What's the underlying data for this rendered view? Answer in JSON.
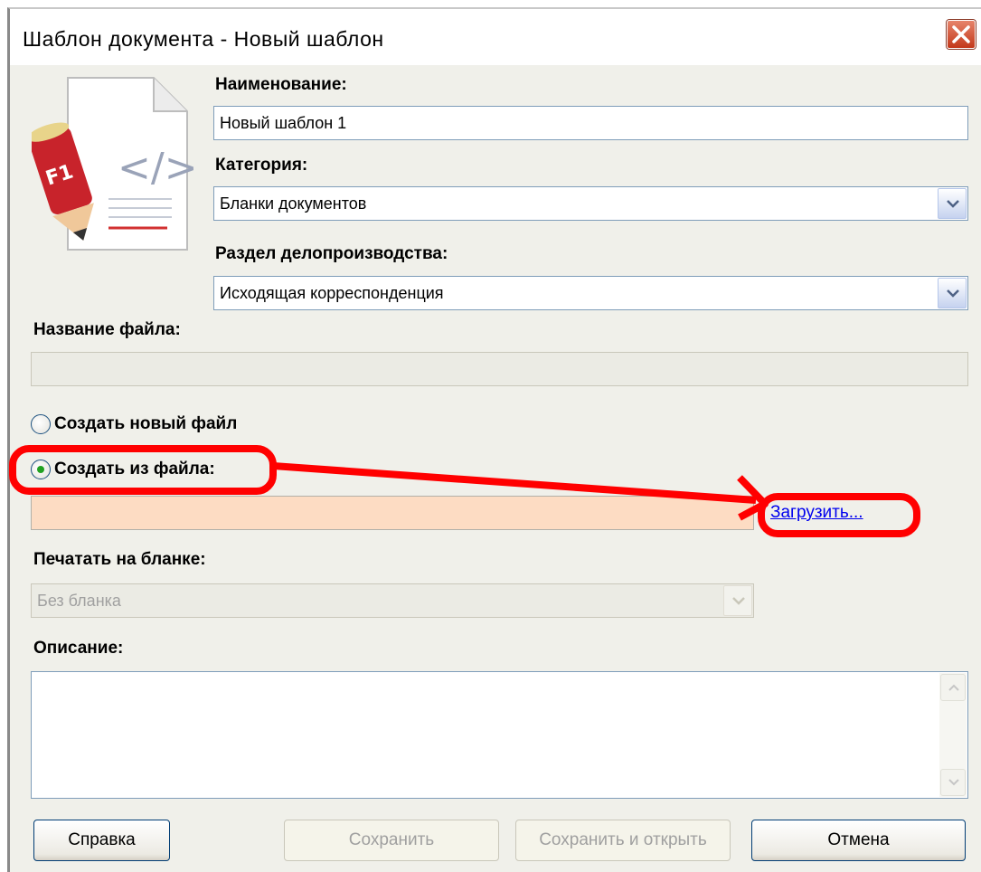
{
  "window": {
    "title": "Шаблон документа - Новый шаблон"
  },
  "form": {
    "name_label": "Наименование:",
    "name_value": "Новый шаблон 1",
    "category_label": "Категория:",
    "category_value": "Бланки документов",
    "section_label": "Раздел делопроизводства:",
    "section_value": "Исходящая корреспонденция",
    "filename_label": "Название файла:",
    "filename_value": "",
    "radio_new_label": "Создать новый файл",
    "radio_from_file_label": "Создать из файла:",
    "radio_selected": "from_file",
    "file_path_value": "",
    "load_link": "Загрузить...",
    "print_label": "Печатать на бланке:",
    "print_value": "Без бланка",
    "description_label": "Описание:",
    "description_value": ""
  },
  "buttons": {
    "help": "Справка",
    "save": "Сохранить",
    "save_open": "Сохранить и открыть",
    "cancel": "Отмена"
  },
  "icons": {
    "document_icon": "document-template-icon",
    "close": "close-icon",
    "dropdown": "chevron-down-icon"
  },
  "colors": {
    "highlight_field": "#fddcc3",
    "annotation": "#ff0000",
    "close_button": "#c3381a"
  }
}
